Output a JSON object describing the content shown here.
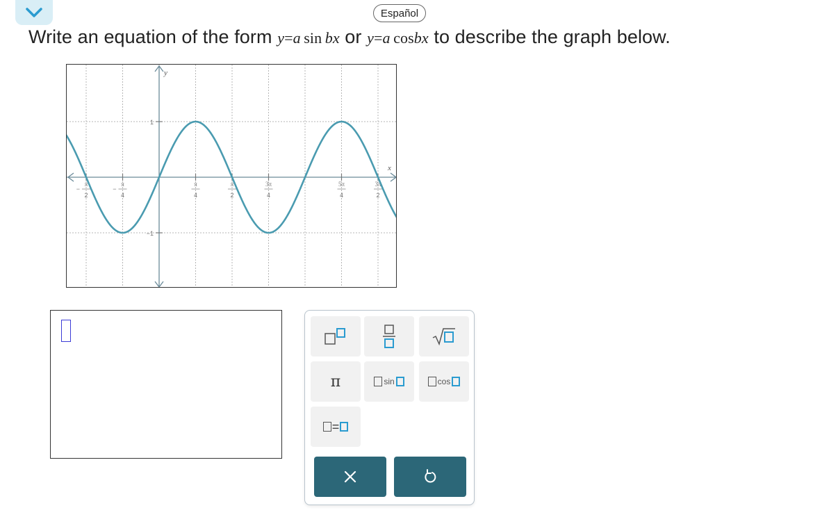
{
  "header": {
    "collapse_icon": "chevron-down-icon",
    "language_label": "Español"
  },
  "question": {
    "prefix": "Write an equation of the form",
    "form1_y": "y",
    "form1_eq": "=",
    "form1_a": "a",
    "form1_fn": "sin",
    "form1_bx": "bx",
    "connector": "or",
    "form2_y": "y",
    "form2_eq": "=",
    "form2_a": "a",
    "form2_fn": "cos",
    "form2_bx": "bx",
    "suffix": "to describe the graph below."
  },
  "graph": {
    "x_axis_label": "x",
    "y_axis_label": "y",
    "y_tick_top": "1",
    "y_tick_bottom": "−1",
    "x_tick_labels": [
      {
        "num": "π",
        "den": "2",
        "sign": "−"
      },
      {
        "num": "π",
        "den": "4",
        "sign": "−"
      },
      {
        "num": "π",
        "den": "4",
        "sign": ""
      },
      {
        "num": "π",
        "den": "2",
        "sign": ""
      },
      {
        "num": "3π",
        "den": "4",
        "sign": ""
      },
      {
        "num": "5π",
        "den": "4",
        "sign": ""
      },
      {
        "num": "3π",
        "den": "2",
        "sign": ""
      }
    ],
    "curve_color": "#4a9bb0",
    "axis_color": "#6a8a99",
    "grid_color": "#b5b5b5"
  },
  "answer": {
    "value": ""
  },
  "palette": {
    "keys": [
      "superscript",
      "fraction",
      "square-root",
      "pi",
      "sine",
      "cosine",
      "equals"
    ],
    "pi_label": "π",
    "sin_label": "sin",
    "cos_label": "cos",
    "equals_label": "=",
    "clear_icon": "close-icon",
    "undo_icon": "undo-icon"
  },
  "colors": {
    "accent_blue": "#2a9bd0",
    "action_button": "#2c6778",
    "collapse_bg": "#d9eef6"
  },
  "chart_data": {
    "type": "line",
    "title": "",
    "xlabel": "x",
    "ylabel": "y",
    "xlim": [
      -1.571,
      1.571
    ],
    "ylim": [
      -1,
      1
    ],
    "grid": true,
    "series": [
      {
        "function": "y = sin(2x)",
        "x": [
          -1.5708,
          -1.1781,
          -0.7854,
          -0.3927,
          0,
          0.3927,
          0.7854,
          1.1781,
          1.5708
        ],
        "y": [
          0,
          -0.707,
          -1,
          -0.707,
          0,
          0.707,
          1,
          0.707,
          0
        ]
      }
    ]
  }
}
